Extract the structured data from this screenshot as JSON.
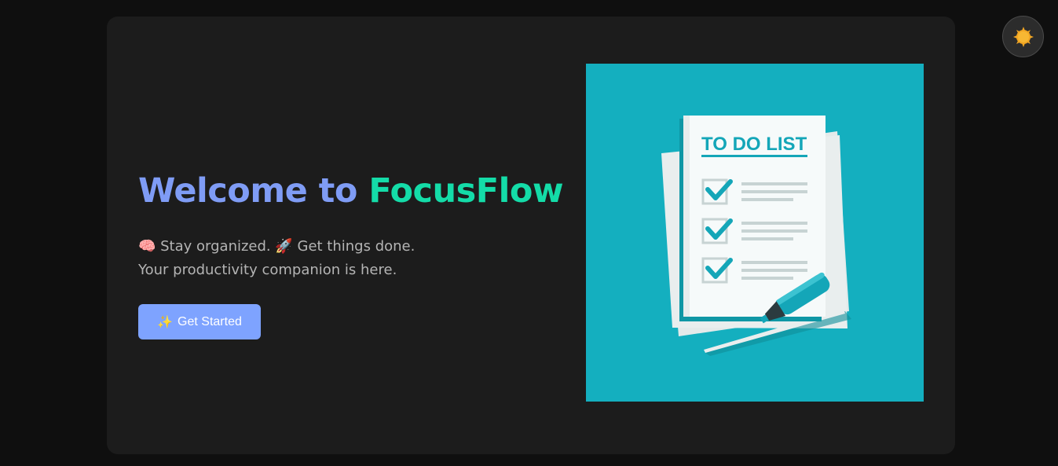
{
  "hero": {
    "title_part1": "Welcome to ",
    "title_part2": "FocusFlow",
    "line1": "🧠 Stay organized. 🚀 Get things done.",
    "line2": "Your productivity companion is here.",
    "cta_icon": "✨",
    "cta_label": "Get Started"
  },
  "illustration": {
    "heading": "TO DO LIST",
    "items_checked": 3
  },
  "theme_toggle": {
    "icon": "sun-icon"
  },
  "colors": {
    "page_bg": "#0f0f0f",
    "card_bg": "#1c1c1c",
    "title_primary": "#7f9cf5",
    "title_accent": "#14dca8",
    "button_bg": "#7ea3ff",
    "illustration_bg": "#14afbf"
  }
}
